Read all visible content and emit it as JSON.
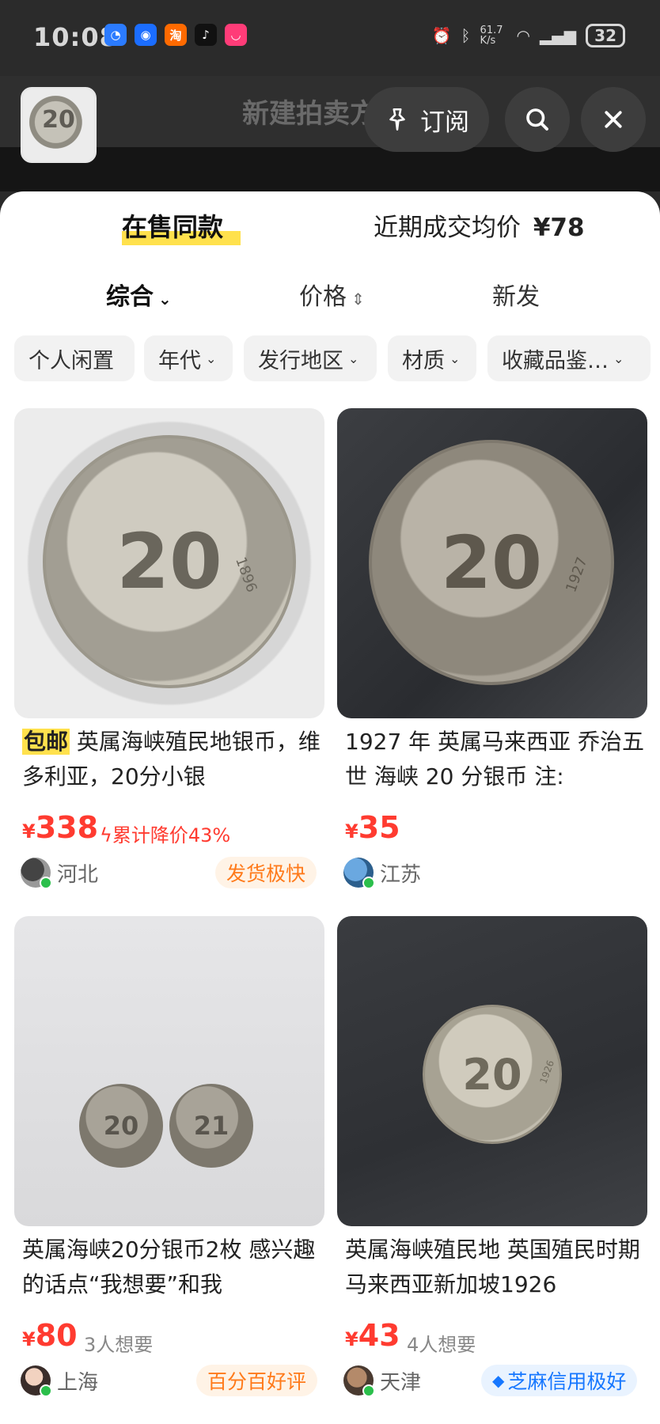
{
  "status_bar": {
    "time": "10:08",
    "net_speed": "61.7 K/s",
    "battery": "32"
  },
  "header": {
    "ghost_title": "新建拍卖方显",
    "thumb_text": "20",
    "subscribe_label": "订阅"
  },
  "tabs": {
    "in_stock": "在售同款",
    "recent_label": "近期成交均价",
    "recent_price": "¥78"
  },
  "sort": {
    "overall": "综合",
    "price": "价格",
    "new": "新发"
  },
  "filters": [
    "个人闲置",
    "年代",
    "发行地区",
    "材质",
    "收藏品鉴…"
  ],
  "products": [
    {
      "badge": "包邮",
      "title": "英属海峡殖民地银币，维多利亚，20分小银",
      "price": "338",
      "extra": "累计降价43%",
      "location": "河北",
      "tag": "发货极快",
      "coin_text": "20",
      "coin_year": "1896"
    },
    {
      "badge": "",
      "title": "1927 年 英属马来西亚 乔治五世 海峡 20 分银币 注:",
      "price": "35",
      "extra": "",
      "location": "江苏",
      "tag": "",
      "coin_text": "20",
      "coin_year": "1927"
    },
    {
      "badge": "",
      "title": "英属海峡20分银币2枚 感兴趣的话点“我想要”和我",
      "price": "80",
      "extra": "3人想要",
      "location": "上海",
      "tag": "百分百好评",
      "coin_text": "20",
      "coin_text_2": "21"
    },
    {
      "badge": "",
      "title": "英属海峡殖民地 英国殖民时期马来西亚新加坡1926",
      "price": "43",
      "extra": "4人想要",
      "location": "天津",
      "tag": "芝麻信用极好",
      "coin_text": "20",
      "coin_year": "1926"
    }
  ],
  "currency_symbol": "¥",
  "colors": {
    "price_red": "#ff3b30",
    "accent_yellow": "#ffe14d",
    "tag_orange": "#ff7a1a",
    "tag_blue": "#1677ff"
  }
}
